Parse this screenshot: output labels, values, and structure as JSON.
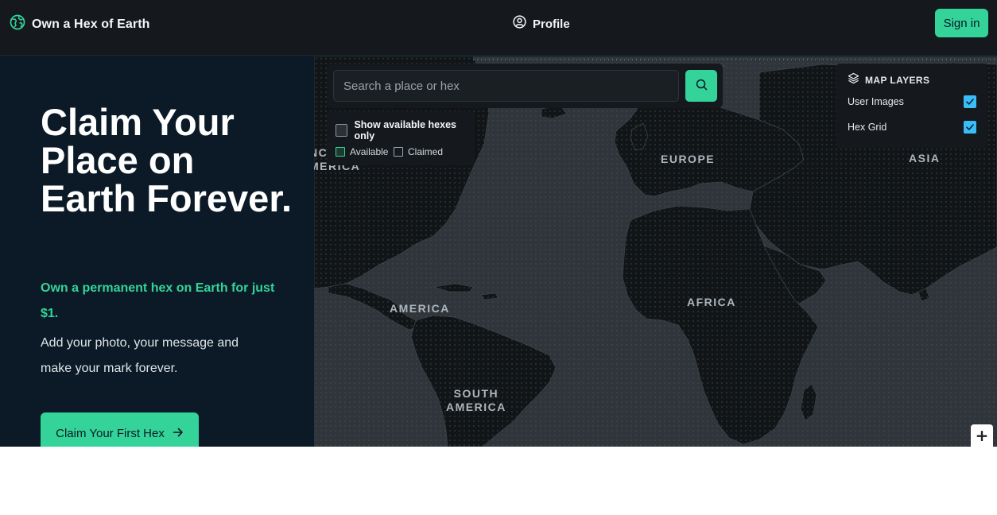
{
  "header": {
    "brand": "Own a Hex of Earth",
    "brand_icon": "globe-icon",
    "profile_label": "Profile",
    "profile_icon": "user-circle-icon",
    "signin_label": "Sign in"
  },
  "hero": {
    "title": "Claim Your Place on Earth Forever.",
    "accent": "Own a permanent hex on Earth for just $1.",
    "body": "Add your photo, your message and make your mark forever.",
    "cta_label": "Claim Your First Hex",
    "cta_icon": "arrow-right-icon"
  },
  "search": {
    "placeholder": "Search a place or hex",
    "button_icon": "search-icon"
  },
  "filter": {
    "label": "Show available hexes only",
    "checked": false,
    "legend": [
      {
        "label": "Available",
        "color": "#34d399"
      },
      {
        "label": "Claimed",
        "color": "#9aa3ab"
      }
    ]
  },
  "layers": {
    "title": "MAP LAYERS",
    "icon": "layers-icon",
    "items": [
      {
        "label": "User Images",
        "checked": true
      },
      {
        "label": "Hex Grid",
        "checked": true
      }
    ]
  },
  "map": {
    "labels": {
      "north_america_fragment": "NC\nMERICA",
      "europe": "EUROPE",
      "asia": "ASIA",
      "america": "AMERICA",
      "africa": "AFRICA",
      "south_america": "SOUTH\nAMERICA"
    },
    "zoom_in": "+"
  },
  "colors": {
    "accent": "#34d399",
    "checkbox": "#38bdf8",
    "header_bg": "#15191d",
    "hero_bg": "#0b1a26",
    "ocean": "#2f353b",
    "land": "#121517"
  }
}
